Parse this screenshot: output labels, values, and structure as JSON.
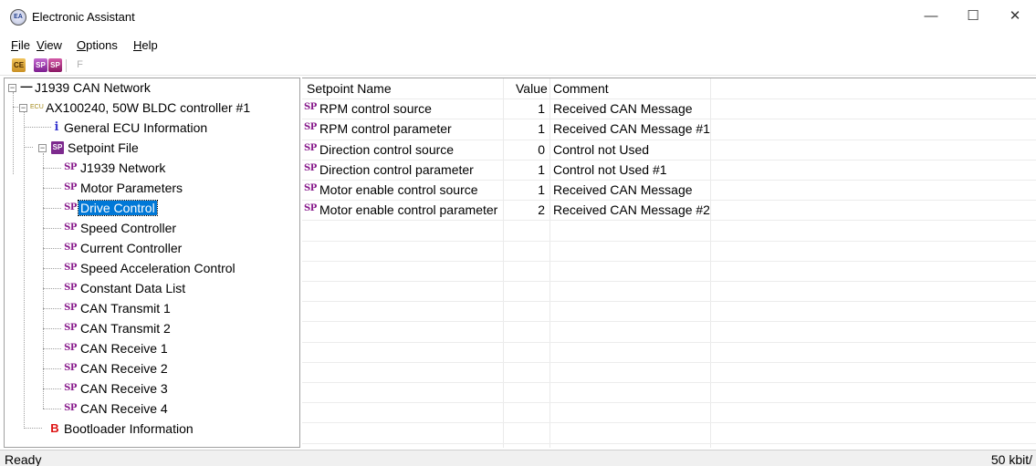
{
  "window": {
    "title": "Electronic Assistant",
    "icon_text": "EA",
    "minimize_glyph": "—",
    "maximize_glyph": "☐",
    "close_glyph": "✕"
  },
  "menu": [
    {
      "accel": "F",
      "rest": "ile"
    },
    {
      "accel": "V",
      "rest": "iew"
    },
    {
      "accel": "O",
      "rest": "ptions"
    },
    {
      "accel": "H",
      "rest": "elp"
    }
  ],
  "toolbar": {
    "btn1": "CE",
    "btn2": "SP",
    "btn3": "SP",
    "btn4": "F"
  },
  "tree": {
    "network": "J1939 CAN Network",
    "ecu_tag": "ECU",
    "ecu": "AX100240, 50W BLDC controller #1",
    "general_info": "General ECU Information",
    "setpoint_file": "Setpoint File",
    "sp_icon": "SP",
    "setpoint_items": [
      "J1939 Network",
      "Motor Parameters",
      "Drive Control",
      "Speed Controller",
      "Current Controller",
      "Speed Acceleration Control",
      "Constant Data List",
      "CAN Transmit 1",
      "CAN Transmit 2",
      "CAN Receive 1",
      "CAN Receive 2",
      "CAN Receive 3",
      "CAN Receive 4"
    ],
    "selected": "Drive Control",
    "bootloader": "Bootloader Information"
  },
  "list": {
    "columns": [
      "Setpoint Name",
      "Value",
      "Comment"
    ],
    "sp_tag": "SP",
    "rows": [
      {
        "name": "RPM control source",
        "value": "1",
        "comment": "Received CAN Message"
      },
      {
        "name": "RPM control parameter",
        "value": "1",
        "comment": "Received CAN Message #1"
      },
      {
        "name": "Direction control source",
        "value": "0",
        "comment": "Control not Used"
      },
      {
        "name": "Direction control parameter",
        "value": "1",
        "comment": "Control not Used #1"
      },
      {
        "name": "Motor enable control source",
        "value": "1",
        "comment": "Received CAN Message"
      },
      {
        "name": "Motor enable control parameter",
        "value": "2",
        "comment": "Received CAN Message #2"
      }
    ]
  },
  "status": {
    "left": "Ready",
    "right": "50 kbit/"
  }
}
